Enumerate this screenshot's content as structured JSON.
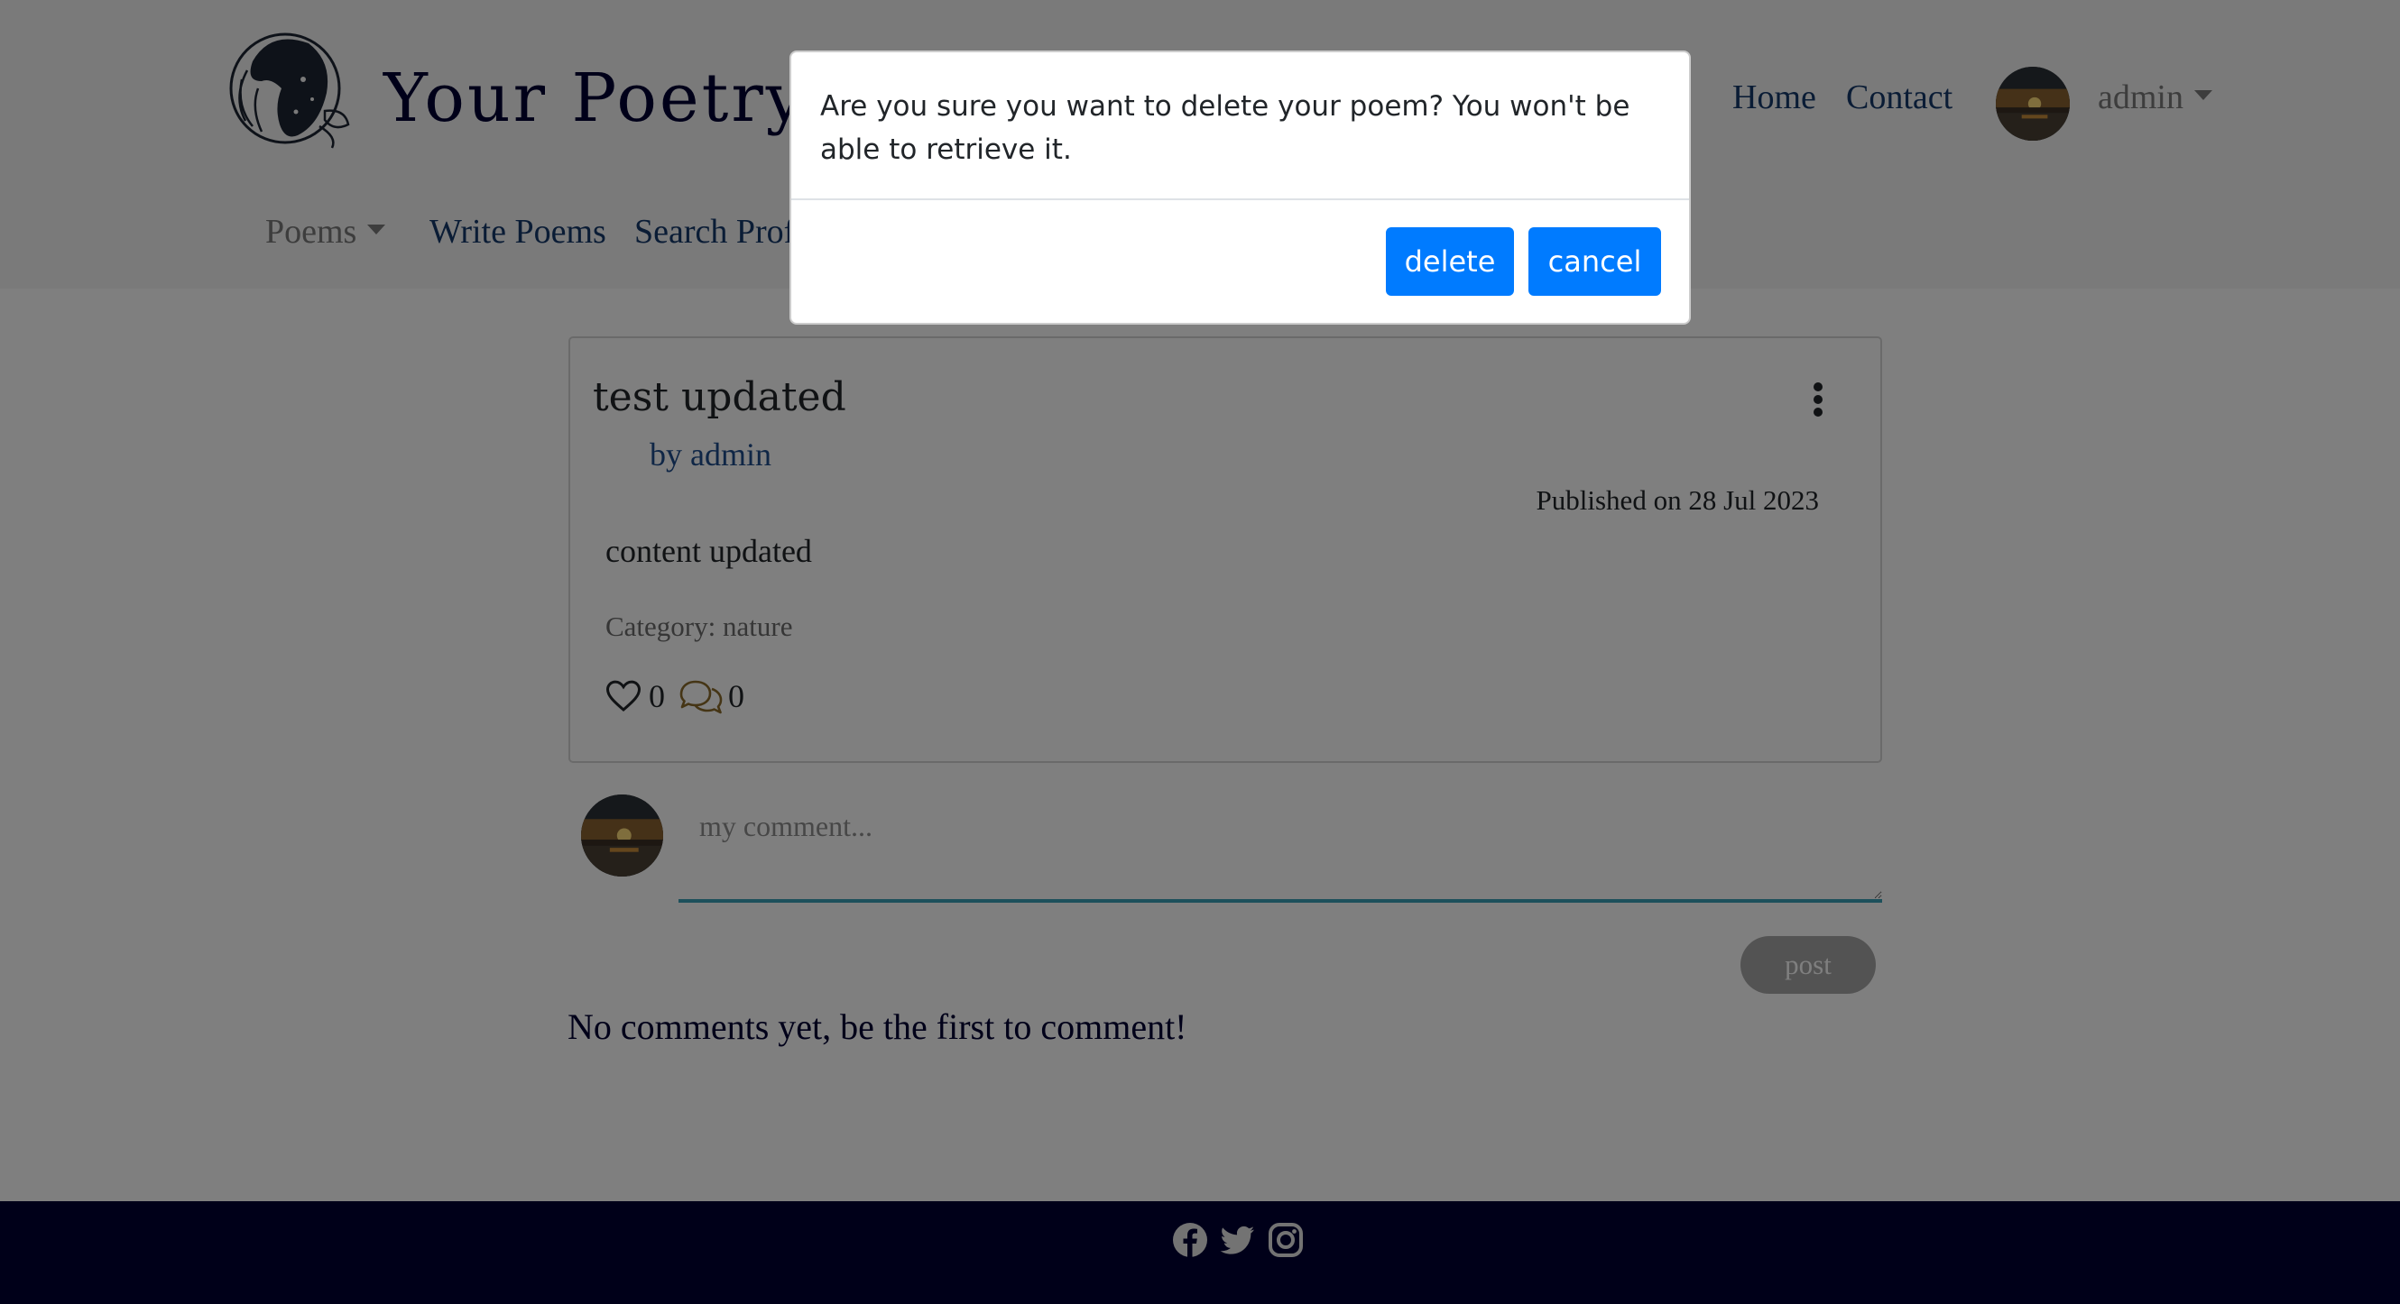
{
  "header": {
    "brand": "Your Poetry",
    "nav": {
      "home": "Home",
      "contact": "Contact"
    },
    "user": {
      "name": "admin"
    },
    "secondary_nav": {
      "poems": "Poems",
      "write_poems": "Write Poems",
      "search_profiles": "Search Profiles"
    }
  },
  "poem": {
    "title": "test updated",
    "author": "by admin",
    "published": "Published on 28 Jul 2023",
    "content": "content updated",
    "category": "Category: nature",
    "likes": "0",
    "comments": "0"
  },
  "comment_form": {
    "placeholder": "my comment...",
    "post_label": "post"
  },
  "comments_section": {
    "empty_message": "No comments yet, be the first to comment!"
  },
  "footer": {
    "icons": [
      "facebook-icon",
      "twitter-icon",
      "instagram-icon"
    ]
  },
  "modal": {
    "message": "Are you sure you want to delete your poem? You won't be able to retrieve it.",
    "delete_label": "delete",
    "cancel_label": "cancel"
  },
  "colors": {
    "primary": "#007bff",
    "navy": "#000033",
    "link_blue": "#14386b",
    "comment_border": "#3ba0b6"
  }
}
